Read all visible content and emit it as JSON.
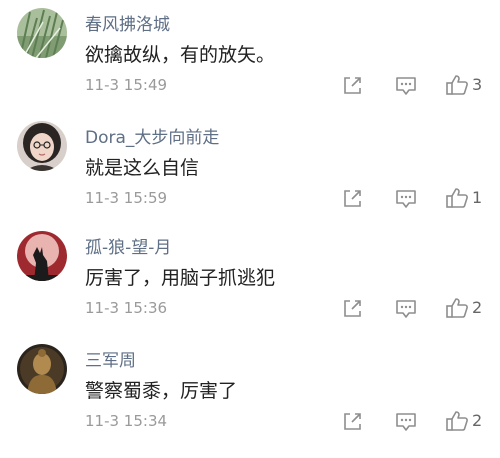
{
  "comments": [
    {
      "name": "春风拂洛城",
      "text": "欲擒故纵，有的放矢。",
      "time": "11-3 15:49",
      "likes": "3",
      "avatar": "grass-avatar"
    },
    {
      "name": "Dora_大步向前走",
      "text": "就是这么自信",
      "time": "11-3 15:59",
      "likes": "1",
      "avatar": "girl-avatar"
    },
    {
      "name": "孤-狼-望-月",
      "text": "厉害了，用脑子抓逃犯",
      "time": "11-3 15:36",
      "likes": "2",
      "avatar": "wolf-moon-avatar"
    },
    {
      "name": "三军周",
      "text": "警察蜀黍，厉害了",
      "time": "11-3 15:34",
      "likes": "2",
      "avatar": "buddha-avatar"
    }
  ],
  "icons": {
    "share": "share-icon",
    "reply": "comment-icon",
    "like": "thumbs-up-icon"
  },
  "colors": {
    "name": "#5f6f86",
    "text": "#222222",
    "time": "#9a9a9a",
    "icon": "#8e8e8e"
  }
}
